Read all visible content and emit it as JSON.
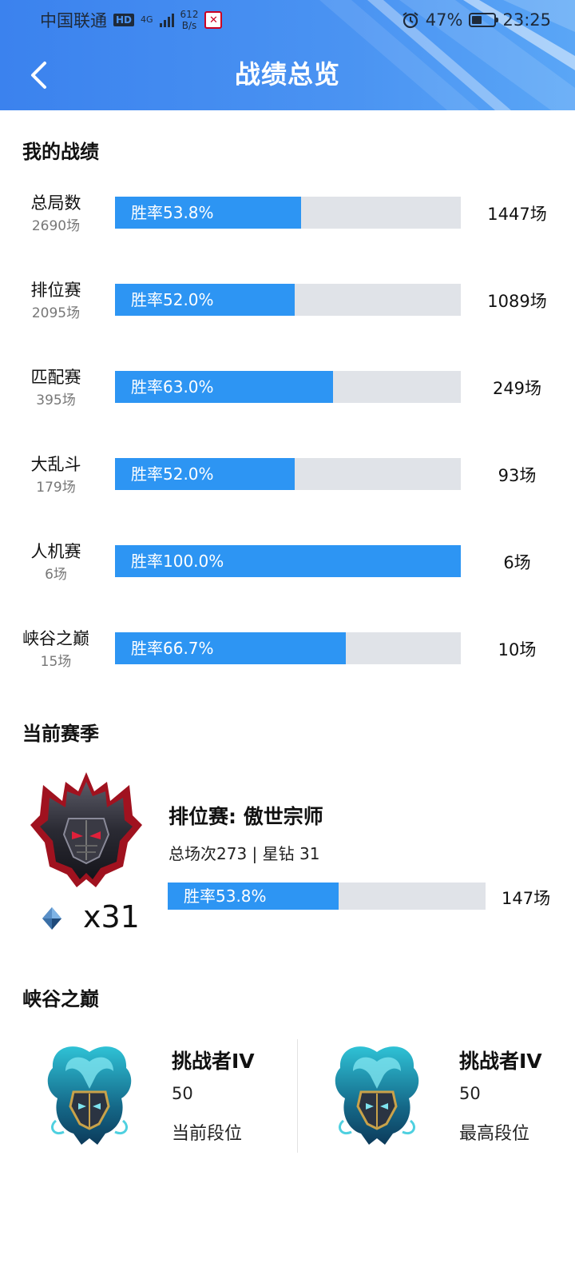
{
  "status_bar": {
    "carrier": "中国联通",
    "hd": "HD",
    "net_type": "4G",
    "speed_value": "612",
    "speed_unit": "B/s",
    "battery": "47%",
    "time": "23:25"
  },
  "header": {
    "title": "战绩总览"
  },
  "my_stats": {
    "title": "我的战绩",
    "rows": [
      {
        "name": "总局数",
        "total": "2690场",
        "winrate_label": "胜率53.8%",
        "winrate": 0.538,
        "wins": "1447场"
      },
      {
        "name": "排位赛",
        "total": "2095场",
        "winrate_label": "胜率52.0%",
        "winrate": 0.52,
        "wins": "1089场"
      },
      {
        "name": "匹配赛",
        "total": "395场",
        "winrate_label": "胜率63.0%",
        "winrate": 0.63,
        "wins": "249场"
      },
      {
        "name": "大乱斗",
        "total": "179场",
        "winrate_label": "胜率52.0%",
        "winrate": 0.52,
        "wins": "93场"
      },
      {
        "name": "人机赛",
        "total": "6场",
        "winrate_label": "胜率100.0%",
        "winrate": 1.0,
        "wins": "6场"
      },
      {
        "name": "峡谷之巅",
        "total": "15场",
        "winrate_label": "胜率66.7%",
        "winrate": 0.667,
        "wins": "10场"
      }
    ]
  },
  "season": {
    "title": "当前赛季",
    "star_count": "x31",
    "rank_title": "排位赛: 傲世宗师",
    "summary": "总场次273 | 星钻 31",
    "winrate_label": "胜率53.8%",
    "winrate": 0.538,
    "wins": "147场",
    "emblem_icon": "grandmaster-emblem-icon",
    "diamond_icon": "star-diamond-icon"
  },
  "peak": {
    "title": "峡谷之巅",
    "cards": [
      {
        "rank": "挑战者IV",
        "score": "50",
        "label": "当前段位"
      },
      {
        "rank": "挑战者IV",
        "score": "50",
        "label": "最高段位"
      }
    ]
  },
  "colors": {
    "header": "#3b82ee",
    "bar_fill": "#2d95f3",
    "bar_track": "#e0e3e8"
  }
}
